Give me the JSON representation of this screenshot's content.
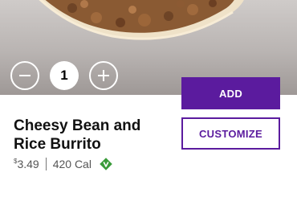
{
  "product": {
    "name": "Cheesy Bean and Rice Burrito",
    "price_symbol": "$",
    "price": "3.49",
    "calories": "420 Cal",
    "badge_icon": "vegetarian-icon",
    "badge_color": "#3a9b3a"
  },
  "quantity": {
    "value": "1",
    "decrement_icon": "minus-icon",
    "increment_icon": "plus-icon"
  },
  "actions": {
    "add_label": "ADD",
    "customize_label": "CUSTOMIZE"
  },
  "colors": {
    "accent": "#5b1b9e"
  }
}
